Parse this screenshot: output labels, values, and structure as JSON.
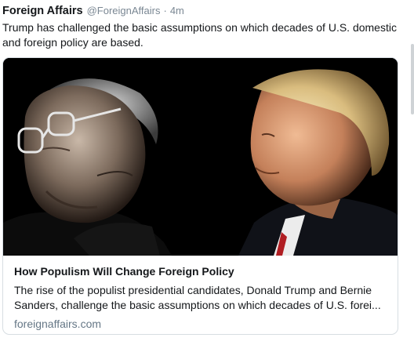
{
  "tweet": {
    "author_name": "Foreign Affairs",
    "author_handle": "@ForeignAffairs",
    "separator": "·",
    "timestamp": "4m",
    "text": "Trump has challenged the basic assumptions on which decades of U.S. domestic and foreign policy are based."
  },
  "card": {
    "image_icon": "photo-portraits",
    "title": "How Populism Will Change Foreign Policy",
    "description": "The rise of the populist presidential candidates, Donald Trump and Bernie Sanders, challenge the basic assumptions on which decades of U.S. forei...",
    "domain": "foreignaffairs.com"
  },
  "colors": {
    "text": "#14171a",
    "muted": "#657786",
    "border": "#d7dde2",
    "image_bg": "#000000"
  }
}
